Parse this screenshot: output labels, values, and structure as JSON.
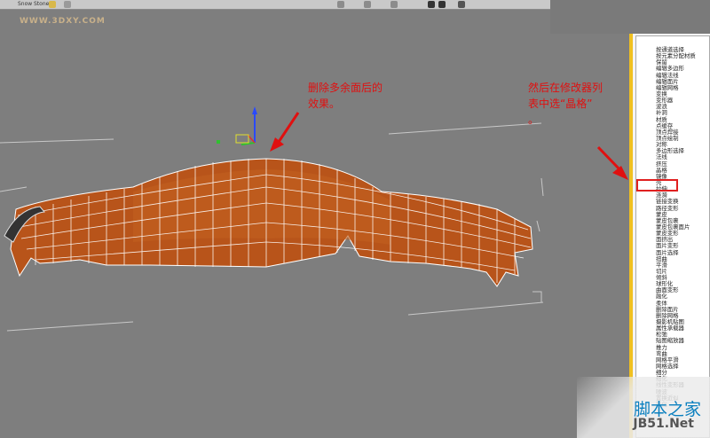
{
  "toolbar": {
    "btn1": "Snow",
    "btn2": "Stone"
  },
  "watermark": "WWW.3DXY.COM",
  "annotations": {
    "left_line1": "删除多余面后的",
    "left_line2": "效果。",
    "right_line1": "然后在修改器列",
    "right_line2": "表中选“晶格”",
    "right_line3": "。"
  },
  "modifiers": [
    "按通道选择",
    "按元素分配材质",
    "保留",
    "编辑多边形",
    "编辑法线",
    "编辑面片",
    "编辑网格",
    "变换",
    "变形器",
    "波浪",
    "补洞",
    "材质",
    "点缓存",
    "顶点焊接",
    "顶点绘制",
    "对称",
    "多边形选择",
    "法线",
    "挤压",
    "晶格",
    "镜像",
    "壳",
    "拉伸",
    "涟漪",
    "链接变换",
    "路径变形",
    "蒙皮",
    "蒙皮包裹",
    "蒙皮包裹面片",
    "蒙皮变形",
    "面挤出",
    "面片变形",
    "面片选择",
    "扭曲",
    "平滑",
    "切片",
    "倾斜",
    "球形化",
    "曲面变形",
    "融化",
    "柔体",
    "删除面片",
    "删除网格",
    "摄影机贴图",
    "属性承载器",
    "松弛",
    "贴图缩放器",
    "推力",
    "弯曲",
    "网格平滑",
    "网格选择",
    "细分",
    "细化",
    "线性变形器",
    "噪波",
    "置换近似",
    "锥化"
  ],
  "selected_modifier": "晶格",
  "logo": {
    "cn": "脚本之家",
    "en": "JB51.Net"
  },
  "colors": {
    "viewport_bg": "#7e7e7e",
    "mesh_fill": "#b8541a",
    "mesh_line": "#ffffff",
    "annotation": "#e01010",
    "selection_band": "#f0c040"
  }
}
